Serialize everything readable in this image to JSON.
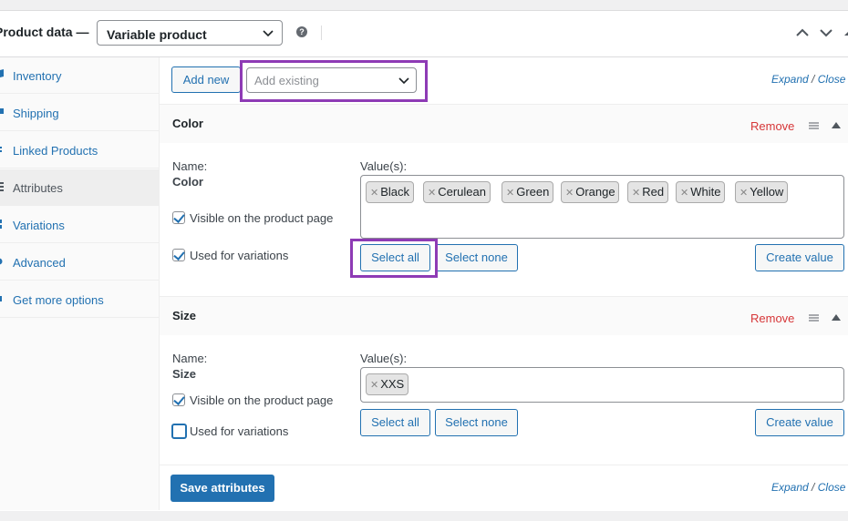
{
  "header": {
    "title": "Product data —",
    "product_type": "Variable product",
    "help": "?"
  },
  "sidebar": {
    "items": [
      {
        "label": "Inventory",
        "active": false
      },
      {
        "label": "Shipping",
        "active": false
      },
      {
        "label": "Linked Products",
        "active": false
      },
      {
        "label": "Attributes",
        "active": true
      },
      {
        "label": "Variations",
        "active": false
      },
      {
        "label": "Advanced",
        "active": false
      },
      {
        "label": "Get more options",
        "active": false
      }
    ]
  },
  "toolbar": {
    "add_new": "Add new",
    "add_existing_placeholder": "Add existing",
    "expand": "Expand",
    "slash": "/",
    "close": "Close"
  },
  "attributes": [
    {
      "name": "Color",
      "remove": "Remove",
      "name_label": "Name:",
      "values_label": "Value(s):",
      "values": [
        "Black",
        "Cerulean",
        "Green",
        "Orange",
        "Red",
        "White",
        "Yellow"
      ],
      "visible_label": "Visible on the product page",
      "visible_checked": true,
      "variations_label": "Used for variations",
      "variations_checked": true,
      "select_all": "Select all",
      "select_none": "Select none",
      "create_value": "Create value"
    },
    {
      "name": "Size",
      "remove": "Remove",
      "name_label": "Name:",
      "values_label": "Value(s):",
      "values": [
        "XXS"
      ],
      "visible_label": "Visible on the product page",
      "visible_checked": true,
      "variations_label": "Used for variations",
      "variations_checked": false,
      "select_all": "Select all",
      "select_none": "Select none",
      "create_value": "Create value"
    }
  ],
  "footer": {
    "save": "Save attributes",
    "expand": "Expand",
    "slash": "/",
    "close": "Close"
  },
  "colors": {
    "accent": "#2271b1",
    "remove": "#d63638",
    "highlight": "#8e3bb5"
  }
}
